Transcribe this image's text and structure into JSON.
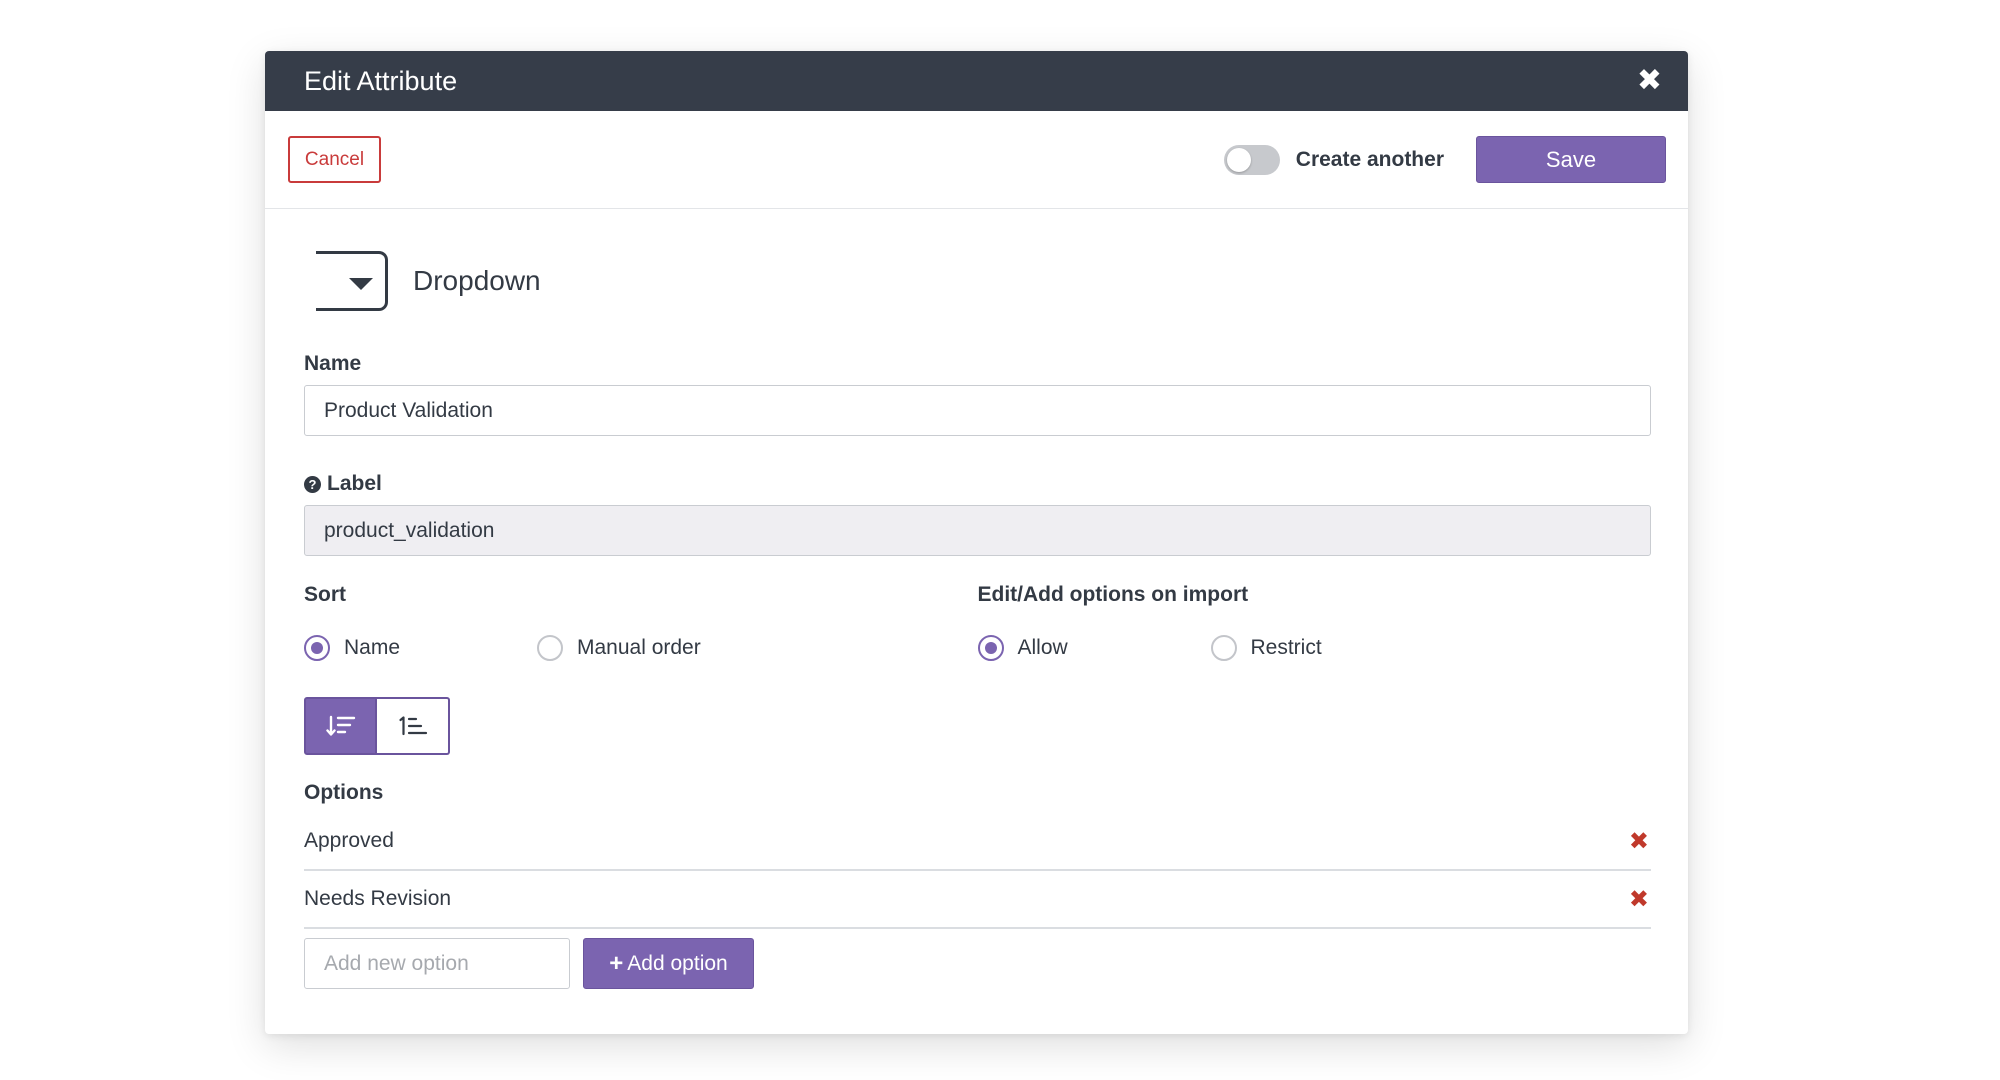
{
  "modal": {
    "title": "Edit Attribute",
    "close_icon": "close-icon"
  },
  "toolbar": {
    "cancel_label": "Cancel",
    "create_another_label": "Create another",
    "create_another_on": false,
    "save_label": "Save"
  },
  "attribute_type": {
    "icon": "dropdown-icon",
    "label": "Dropdown"
  },
  "name_field": {
    "label": "Name",
    "value": "Product Validation"
  },
  "label_field": {
    "label": "Label",
    "help_icon": "question-circle-icon",
    "value": "product_validation"
  },
  "sort": {
    "label": "Sort",
    "options": [
      "Name",
      "Manual order"
    ],
    "selected": "Name"
  },
  "import": {
    "label": "Edit/Add options on import",
    "options": [
      "Allow",
      "Restrict"
    ],
    "selected": "Allow"
  },
  "sort_direction": {
    "active": "sort-ascending",
    "buttons": [
      "sort-ascending-icon",
      "sort-numeric-icon"
    ]
  },
  "options": {
    "label": "Options",
    "items": [
      "Approved",
      "Needs Revision"
    ],
    "add_placeholder": "Add new option",
    "add_button_label": "Add option"
  },
  "colors": {
    "header": "#363d49",
    "accent": "#7b64b0",
    "danger": "#c93b3b"
  }
}
